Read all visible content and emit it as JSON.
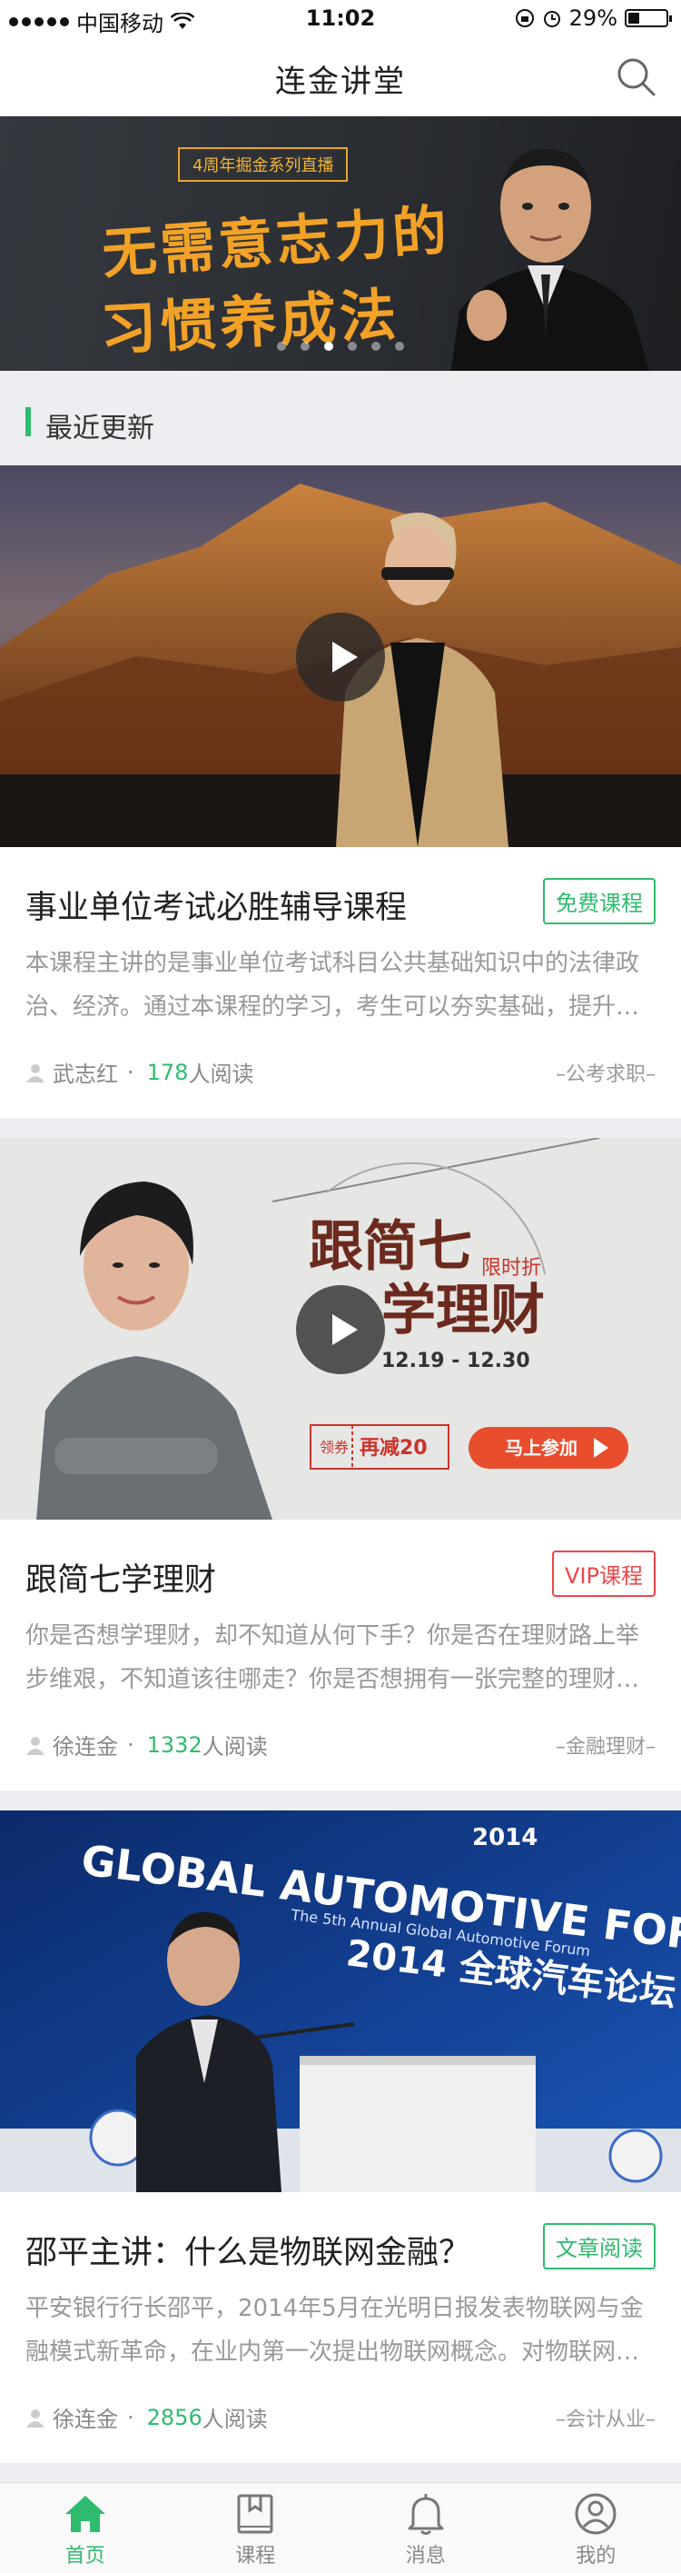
{
  "status_bar": {
    "carrier": "中国移动",
    "time": "11:02",
    "battery": "29%",
    "battery_level": 0.29
  },
  "header": {
    "title": "连金讲堂",
    "search_icon": "search-icon"
  },
  "banner": {
    "tagline": "4周年掘金系列直播",
    "headline_line1": "无需意志力的",
    "headline_line2": "习惯养成法",
    "slide_count": 6,
    "active_slide": 3
  },
  "section": {
    "title": "最近更新"
  },
  "articles": [
    {
      "title": "事业单位考试必胜辅导课程",
      "badge": "免费课程",
      "desc": "本课程主讲的是事业单位考试科目公共基础知识中的法律政治、经济。通过本课程的学习，考生可以夯实基础，提升…",
      "author": "武志红",
      "dot": "·",
      "reads": "178",
      "reads_unit": "人阅读",
      "category": "–公考求职–"
    },
    {
      "title": "跟简七学理财",
      "badge": "VIP课程",
      "desc": "你是否想学理财，却不知道从何下手？你是否在理财路上举步维艰，不知道该往哪走？你是否想拥有一张完整的理财…",
      "author": "徐连金",
      "dot": "·",
      "reads": "1332",
      "reads_unit": "人阅读",
      "category": "–金融理财–",
      "promo": {
        "title1": "跟简七",
        "title2": "学理财",
        "tag": "限时折",
        "dates": "12.19 - 12.30",
        "coupon_label": "领券",
        "coupon_value": "再减20",
        "cta": "马上参加"
      }
    },
    {
      "title": "邵平主讲：什么是物联网金融？",
      "badge": "文章阅读",
      "desc": "平安银行行长邵平，2014年5月在光明日报发表物联网与金融模式新革命，在业内第一次提出物联网概念。对物联网…",
      "author": "徐连金",
      "dot": "·",
      "reads": "2856",
      "reads_unit": "人阅读",
      "category": "–会计从业–",
      "photo": {
        "line1": "GLOBAL AUTOMOTIVE FORUM",
        "line2": "2014 全球汽车论坛",
        "year": "2014",
        "sub": "The 5th Annual Global Automotive Forum"
      }
    }
  ],
  "tabbar": [
    {
      "label": "首页",
      "icon": "home-icon",
      "active": true
    },
    {
      "label": "课程",
      "icon": "book-icon",
      "active": false
    },
    {
      "label": "消息",
      "icon": "bell-icon",
      "active": false
    },
    {
      "label": "我的",
      "icon": "user-icon",
      "active": false
    }
  ],
  "colors": {
    "accent": "#2fbb6e",
    "vip": "#f0454b",
    "banner_text": "#f2a227"
  }
}
